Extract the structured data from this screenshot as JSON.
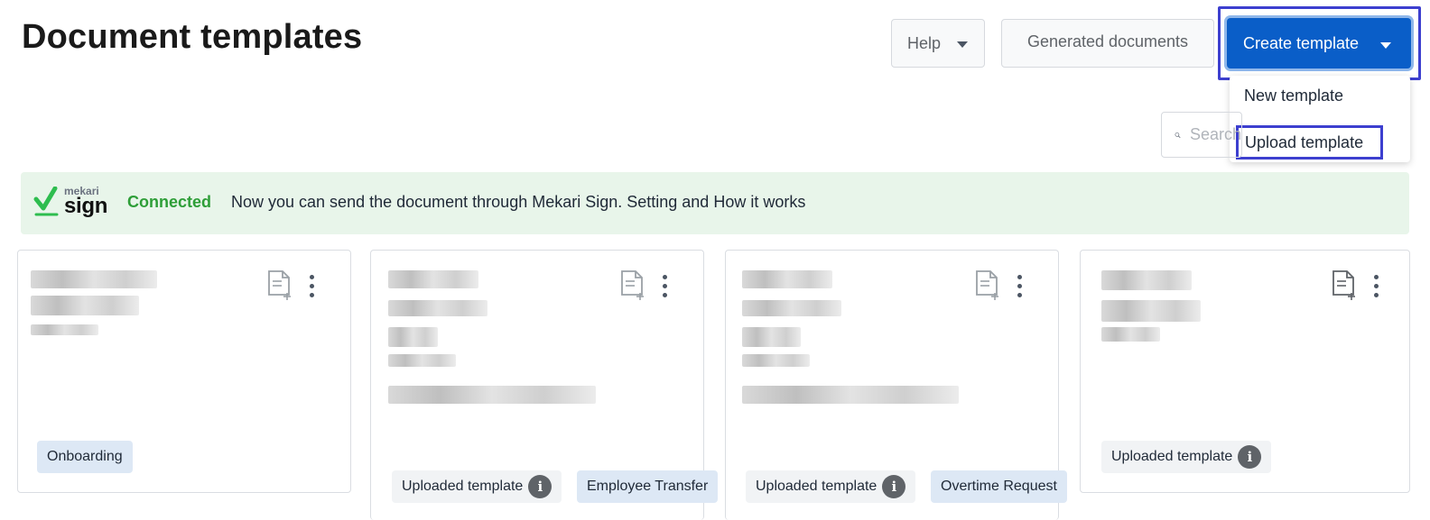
{
  "header": {
    "title": "Document templates",
    "help_label": "Help",
    "generated_label": "Generated documents",
    "create_label": "Create template"
  },
  "create_menu": {
    "items": [
      "New template",
      "Upload template"
    ]
  },
  "search": {
    "placeholder": "Search"
  },
  "banner": {
    "logo_top": "mekari",
    "logo_main": "sign",
    "status": "Connected",
    "message": "Now you can send the document through Mekari Sign. Setting and How it works",
    "status_color": "#2e9e38",
    "bg_color": "#e8f5ea"
  },
  "cards": [
    {
      "tags": [
        {
          "label": "Onboarding",
          "style": "blue"
        }
      ]
    },
    {
      "tags": [
        {
          "label": "Uploaded template",
          "style": "gray",
          "info": true
        },
        {
          "label": "Employee Transfer",
          "style": "blue"
        }
      ]
    },
    {
      "tags": [
        {
          "label": "Uploaded template",
          "style": "gray",
          "info": true
        },
        {
          "label": "Overtime Request",
          "style": "blue"
        }
      ]
    },
    {
      "tags": [
        {
          "label": "Uploaded template",
          "style": "gray",
          "info": true
        }
      ]
    }
  ],
  "icons": {
    "doc": "document-add-icon",
    "more": "more-vertical-icon",
    "info": "info-icon",
    "search": "search-icon"
  },
  "colors": {
    "primary": "#0a5ec8",
    "highlight": "#3d3fcf"
  }
}
